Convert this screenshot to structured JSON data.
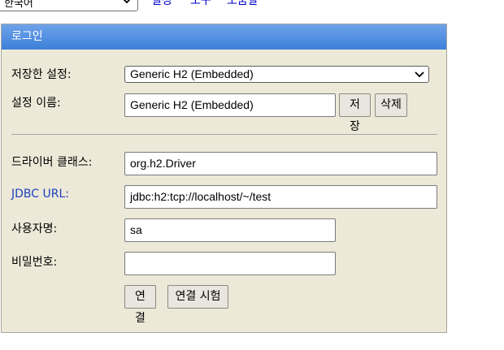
{
  "topbar": {
    "language_selected": "한국어",
    "links": [
      "설정",
      "도구",
      "도움말"
    ]
  },
  "panel": {
    "title": "로그인",
    "saved_settings_label": "저장한 설정:",
    "saved_settings_value": "Generic H2 (Embedded)",
    "setting_name_label": "설정 이름:",
    "setting_name_value": "Generic H2 (Embedded)",
    "save_button": "저장",
    "delete_button": "삭제",
    "driver_class_label": "드라이버 클래스:",
    "driver_class_value": "org.h2.Driver",
    "jdbc_url_label": "JDBC URL:",
    "jdbc_url_value": "jdbc:h2:tcp://localhost/~/test",
    "username_label": "사용자명:",
    "username_value": "sa",
    "password_label": "비밀번호:",
    "password_value": "",
    "connect_button": "연결",
    "test_connection_button": "연결 시험"
  },
  "colors": {
    "header_gradient_top": "#6fa3ea",
    "header_gradient_bottom": "#3c7fd9",
    "panel_background": "#ece9d8",
    "link": "#0000cc",
    "jdbc_label": "#1d3fbf"
  }
}
